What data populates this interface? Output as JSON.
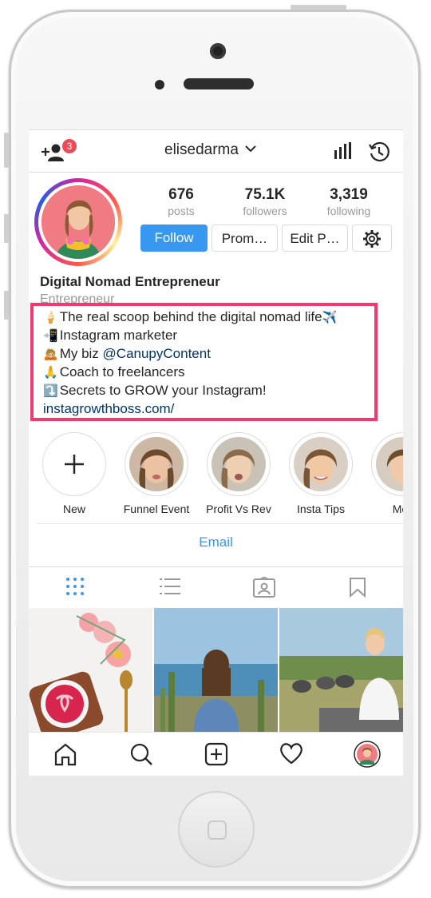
{
  "header": {
    "username": "elisedarma",
    "notification_count": "3",
    "icons": [
      "add-user-icon",
      "chevron-down-icon",
      "insights-icon",
      "archive-clock-icon"
    ]
  },
  "profile": {
    "stats": [
      {
        "value": "676",
        "label": "posts"
      },
      {
        "value": "75.1K",
        "label": "followers"
      },
      {
        "value": "3,319",
        "label": "following"
      }
    ],
    "buttons": {
      "follow": "Follow",
      "promote": "Prom…",
      "edit": "Edit P…"
    },
    "display_name": "Digital Nomad Entrepreneur",
    "category": "Entrepreneur",
    "bio": {
      "line1_text": "The real scoop behind the digital nomad life",
      "line1_emoji_start": "🍦",
      "line1_emoji_end": "✈️",
      "line2_emoji": "📲",
      "line2_text": "Instagram marketer",
      "line3_emoji": "🙇🏼",
      "line3_text": "My biz ",
      "line3_mention": "@CanupyContent",
      "line4_emoji": "🙏",
      "line4_text": "Coach to freelancers",
      "line5_emoji": "⤵️",
      "line5_text": "Secrets to GROW your Instagram!",
      "website": "instagrowthboss.com/"
    }
  },
  "highlights": [
    {
      "label": "New"
    },
    {
      "label": "Funnel Event"
    },
    {
      "label": "Profit Vs Rev"
    },
    {
      "label": "Insta Tips"
    },
    {
      "label": "Mex"
    }
  ],
  "contact": {
    "email_label": "Email"
  },
  "tabs": [
    "grid-icon",
    "list-icon",
    "tagged-icon",
    "saved-icon"
  ],
  "colors": {
    "accent": "#3897f0",
    "highlight_box": "#f5386d",
    "badge": "#ed4956"
  },
  "bottom_nav": [
    "home-icon",
    "search-icon",
    "new-post-icon",
    "activity-icon",
    "profile-avatar"
  ]
}
